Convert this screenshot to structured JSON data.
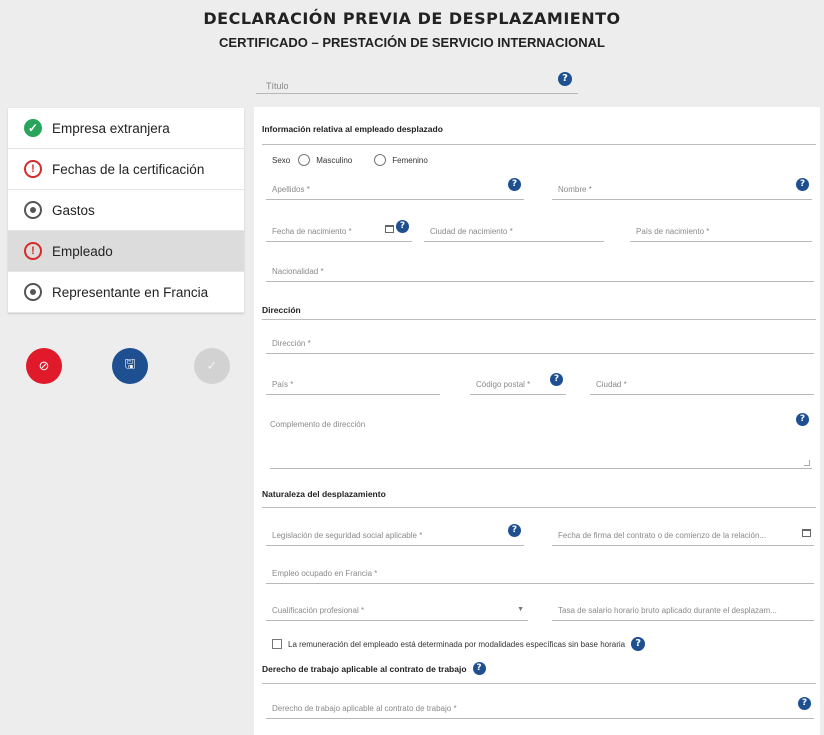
{
  "header": {
    "title": "DECLARACIÓN PREVIA DE DESPLAZAMIENTO",
    "subtitle": "CERTIFICADO – PRESTACIÓN DE SERVICIO INTERNACIONAL"
  },
  "title_field": {
    "placeholder": "Título"
  },
  "sidebar": {
    "items": [
      {
        "label": "Empresa extranjera",
        "status": "check-icon"
      },
      {
        "label": "Fechas de la certificación",
        "status": "warning-icon"
      },
      {
        "label": "Gastos",
        "status": "radio-dot-icon"
      },
      {
        "label": "Empleado",
        "status": "warning-icon",
        "active": true
      },
      {
        "label": "Representante en Francia",
        "status": "radio-dot-icon"
      }
    ]
  },
  "actions": {
    "cancel_icon": "⊘",
    "save_icon": "🖫",
    "confirm_icon": "✓",
    "colors": {
      "cancel": "#e11a2b",
      "save": "#1d4f91",
      "confirm_disabled": "#d2d2d2"
    }
  },
  "help_glyph": "?",
  "form": {
    "section_empleado": "Información relativa al empleado desplazado",
    "sexo_label": "Sexo",
    "sexo_options": [
      "Masculino",
      "Femenino"
    ],
    "apellidos": "Apellidos *",
    "nombre": "Nombre *",
    "fecha_nacimiento": "Fecha de nacimiento *",
    "ciudad_nacimiento": "Ciudad de nacimiento *",
    "pais_nacimiento": "País de nacimiento *",
    "nacionalidad": "Nacionalidad *",
    "section_direccion": "Dirección",
    "direccion": "Dirección *",
    "pais": "País *",
    "codigo_postal": "Código postal *",
    "ciudad": "Ciudad *",
    "complemento": "Complemento de dirección",
    "section_naturaleza": "Naturaleza del desplazamiento",
    "legislacion": "Legislación de seguridad social aplicable *",
    "fecha_firma": "Fecha de firma del contrato o de comienzo de la relación...",
    "empleo": "Empleo ocupado en Francia *",
    "cualificacion": "Cualificación profesional *",
    "tasa_salario": "Tasa de salario horario bruto aplicado durante el desplazam...",
    "remuneracion_check": "La remuneración del empleado está determinada por modalidades específicas sin base horaria",
    "section_derecho": "Derecho de trabajo aplicable al contrato de trabajo",
    "derecho": "Derecho de trabajo aplicable al contrato de trabajo *"
  }
}
